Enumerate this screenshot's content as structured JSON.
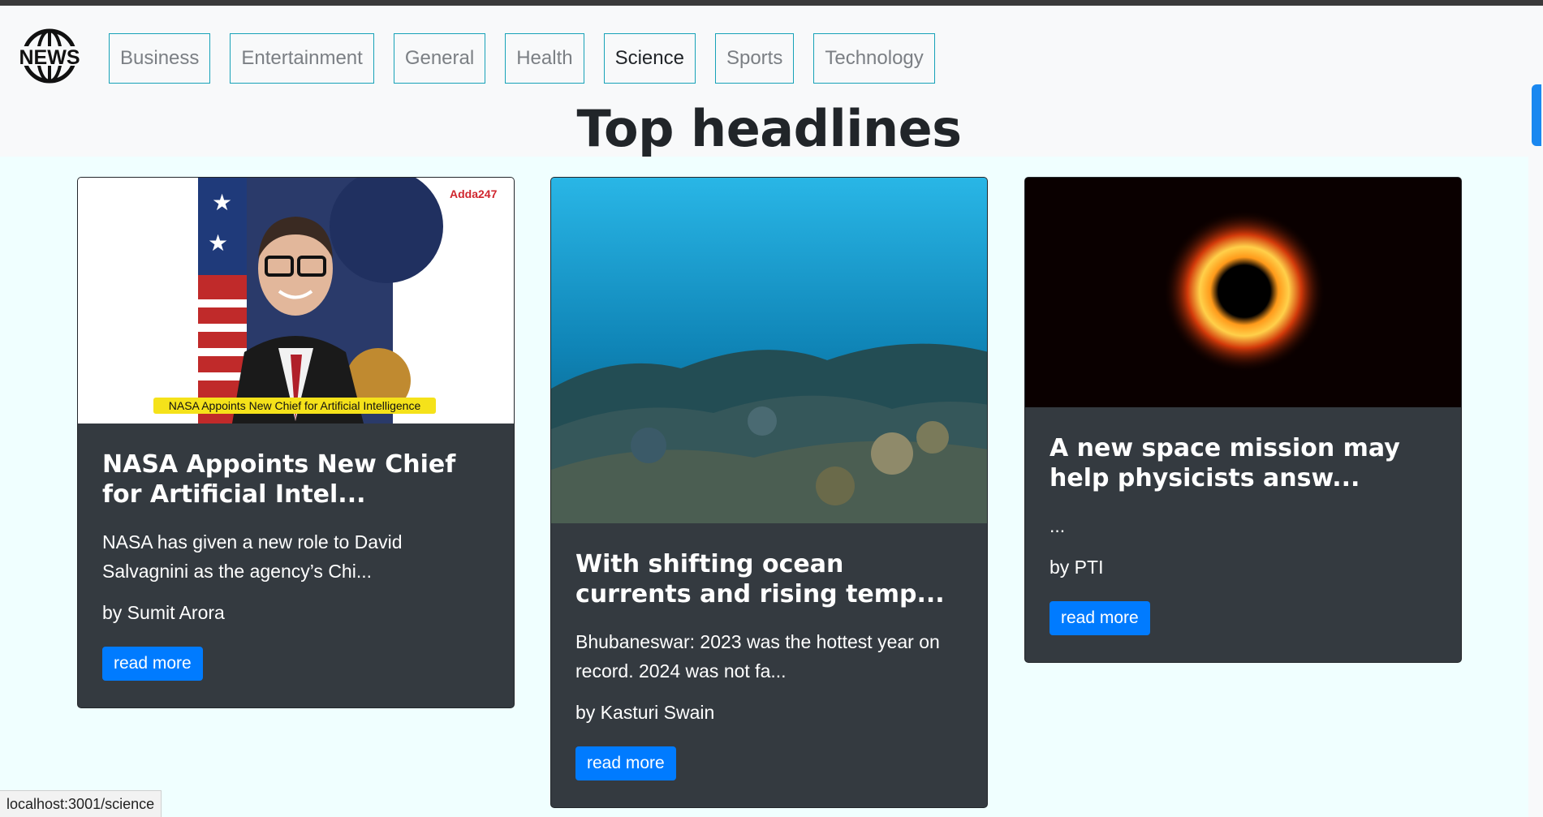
{
  "brand": {
    "logo_text": "NEWS"
  },
  "nav": {
    "items": [
      {
        "label": "Business",
        "active": false
      },
      {
        "label": "Entertainment",
        "active": false
      },
      {
        "label": "General",
        "active": false
      },
      {
        "label": "Health",
        "active": false
      },
      {
        "label": "Science",
        "active": true
      },
      {
        "label": "Sports",
        "active": false
      },
      {
        "label": "Technology",
        "active": false
      }
    ]
  },
  "main": {
    "heading": "Top headlines",
    "articles": [
      {
        "image_caption": "NASA Appoints New Chief for Artificial Intelligence",
        "image_watermark": "Adda247",
        "title": "NASA Appoints New Chief for Artificial Intel...",
        "description": "NASA has given a new role to David Salvagnini as the agency’s Chi...",
        "author": "by Sumit Arora",
        "button": "read more"
      },
      {
        "title": "With shifting ocean currents and rising temp...",
        "description": "Bhubaneswar: 2023 was the hottest year on record. 2024 was not fa...",
        "author": "by Kasturi Swain",
        "button": "read more"
      },
      {
        "title": "A new space mission may help physicists answ...",
        "description": "...",
        "author": "by PTI",
        "button": "read more"
      }
    ]
  },
  "statusbar": {
    "url": "localhost:3001/science"
  },
  "colors": {
    "nav_border": "#17a2b8",
    "card_bg": "#343a40",
    "button": "#007bff",
    "page_bg": "#f0ffff"
  }
}
